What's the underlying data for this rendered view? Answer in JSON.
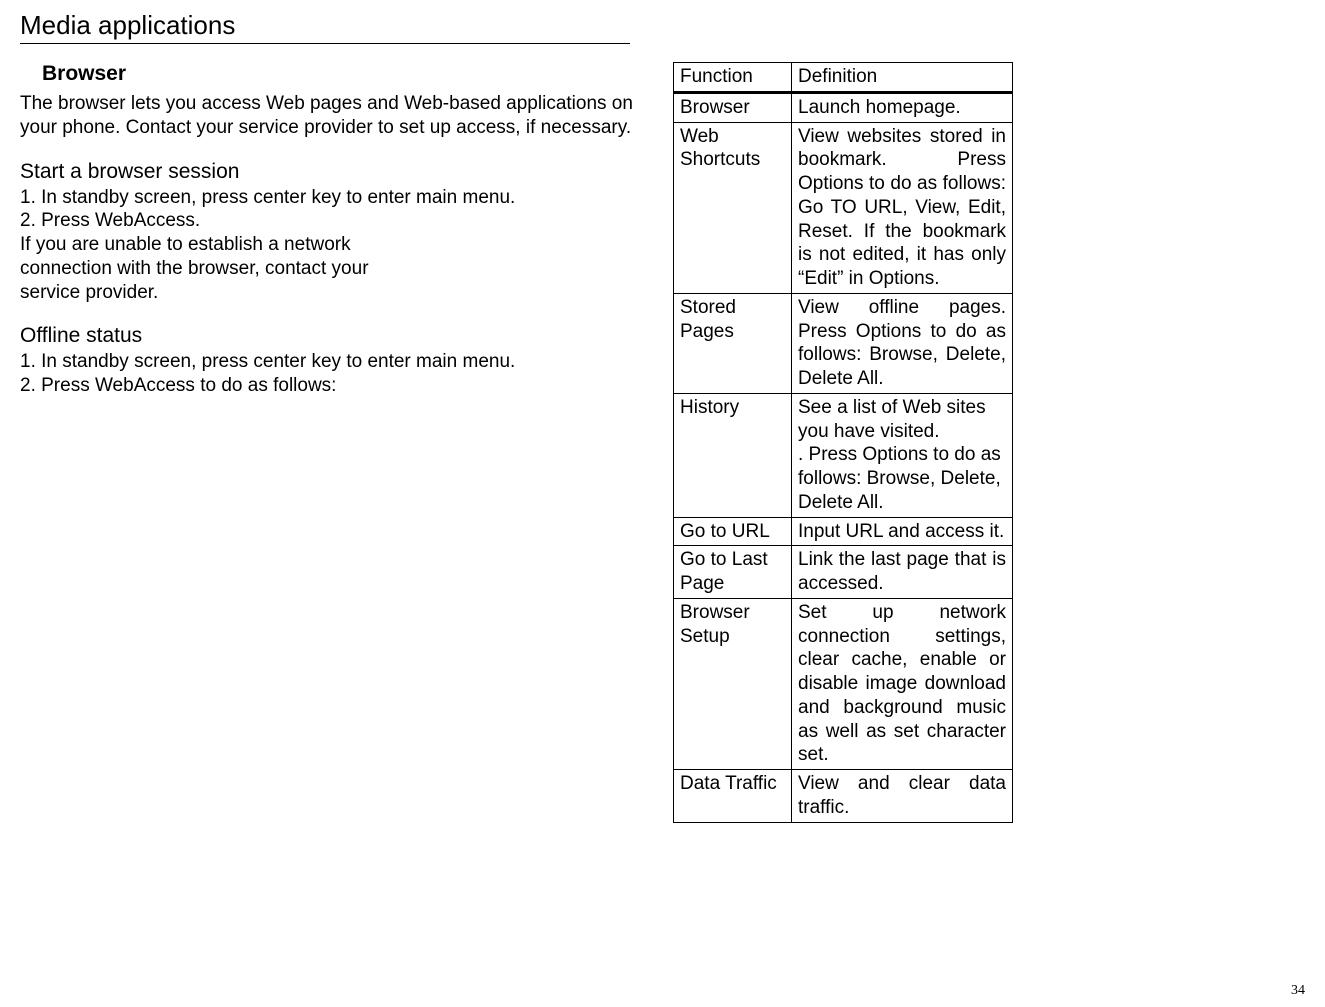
{
  "pageHeader": "Media applications",
  "browser": {
    "title": "Browser",
    "intro": "The browser lets you access Web pages and Web-based applications on your phone. Contact your service provider to set up access, if necessary."
  },
  "startSession": {
    "heading": "Start a browser session",
    "line1": "1. In standby screen, press center key to enter main menu.",
    "line2": "2. Press WebAccess.",
    "line3": "If you are unable to establish a network",
    "line4": "connection with the browser, contact your",
    "line5": "service provider."
  },
  "offlineStatus": {
    "heading": "Offline status",
    "line1": "1. In standby screen, press center key to enter main menu.",
    "line2": "2. Press WebAccess to do as follows:"
  },
  "table": {
    "headerFunc": "Function",
    "headerDef": "Definition",
    "rows": [
      {
        "func": "Browser",
        "def": "Launch homepage."
      },
      {
        "func": "Web Shortcuts",
        "def": "View websites stored in bookmark. Press Options to do as follows: Go TO URL, View, Edit, Reset. If the bookmark is not edited, it has only “Edit” in Options."
      },
      {
        "func": "Stored Pages",
        "def": "View offline pages. Press Options to do as follows: Browse, Delete, Delete All."
      },
      {
        "func": "History",
        "def": "See a list of Web sites you have visited.\n. Press Options to do as follows: Browse, Delete, Delete All."
      },
      {
        "func": "Go to URL",
        "def": "Input URL and access it."
      },
      {
        "func": "Go to Last Page",
        "def": "Link the last page that is accessed."
      },
      {
        "func": "Browser Setup",
        "def": "Set up network connection settings, clear cache, enable or disable image download and background music as well as set character set."
      },
      {
        "func": "Data Traffic",
        "def": "View and clear data traffic."
      }
    ]
  },
  "pageNumber": "34"
}
